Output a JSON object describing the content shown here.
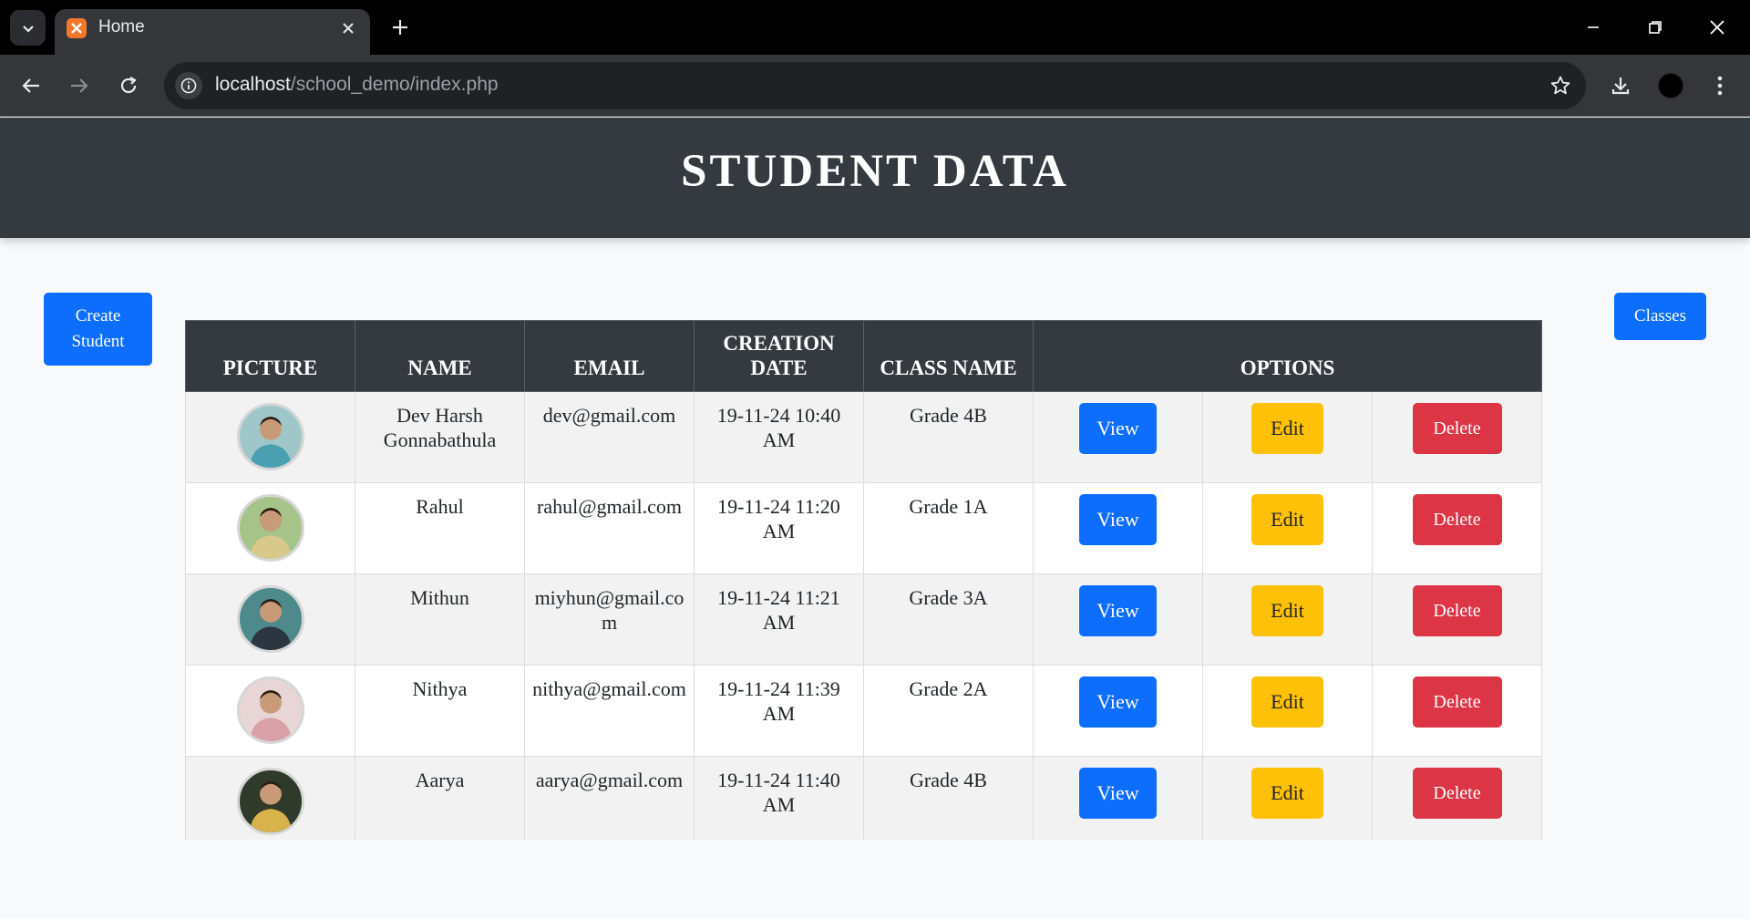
{
  "browser": {
    "tab_title": "Home",
    "url_host": "localhost",
    "url_path": "/school_demo/index.php"
  },
  "header": {
    "title": "STUDENT DATA"
  },
  "actions": {
    "create_label": "Create Student",
    "classes_label": "Classes"
  },
  "table": {
    "columns": [
      "PICTURE",
      "NAME",
      "EMAIL",
      "CREATION DATE",
      "CLASS NAME",
      "OPTIONS"
    ],
    "buttons": {
      "view": "View",
      "edit": "Edit",
      "delete": "Delete"
    },
    "rows": [
      {
        "name": "Dev Harsh Gonnabathula",
        "email": "dev@gmail.com",
        "date": "19-11-24 10:40 AM",
        "class": "Grade 4B",
        "avatar_color": "#4a9fb0",
        "avatar_bg": "#9fc7c9"
      },
      {
        "name": "Rahul",
        "email": "rahul@gmail.com",
        "date": "19-11-24 11:20 AM",
        "class": "Grade 1A",
        "avatar_color": "#d8c98a",
        "avatar_bg": "#a6c48a"
      },
      {
        "name": "Mithun",
        "email": "miyhun@gmail.com",
        "date": "19-11-24 11:21 AM",
        "class": "Grade 3A",
        "avatar_color": "#2c3640",
        "avatar_bg": "#4e8a8c"
      },
      {
        "name": "Nithya",
        "email": "nithya@gmail.com",
        "date": "19-11-24 11:39 AM",
        "class": "Grade 2A",
        "avatar_color": "#d9a0a8",
        "avatar_bg": "#e8d6d6"
      },
      {
        "name": "Aarya",
        "email": "aarya@gmail.com",
        "date": "19-11-24 11:40 AM",
        "class": "Grade 4B",
        "avatar_color": "#d8b24a",
        "avatar_bg": "#2f3a2a"
      }
    ]
  }
}
